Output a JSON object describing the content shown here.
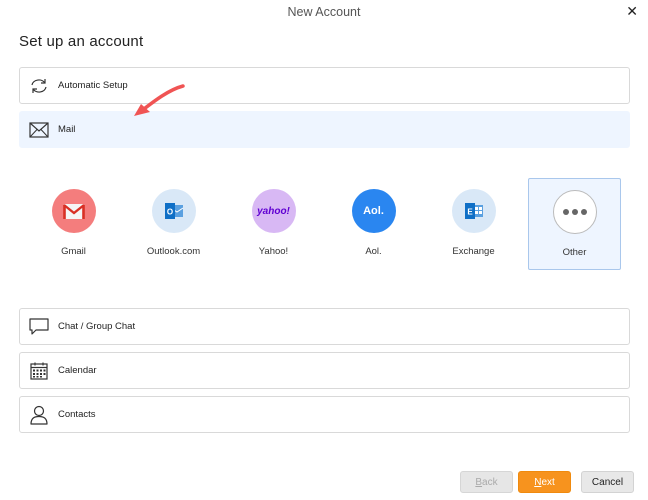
{
  "window": {
    "title": "New Account"
  },
  "heading": "Set up an account",
  "rows": [
    {
      "label": "Automatic Setup",
      "icon": "refresh-icon"
    },
    {
      "label": "Mail",
      "icon": "envelope-icon"
    },
    {
      "label": "Chat / Group Chat",
      "icon": "chat-bubble-icon"
    },
    {
      "label": "Calendar",
      "icon": "calendar-icon"
    },
    {
      "label": "Contacts",
      "icon": "person-icon"
    }
  ],
  "providers": [
    {
      "label": "Gmail",
      "color": "#f47d7d"
    },
    {
      "label": "Outlook.com",
      "color": "#d9e8f7"
    },
    {
      "label": "Yahoo!",
      "color": "#d8b8f4"
    },
    {
      "label": "Aol.",
      "logo_text": "Aol.",
      "color": "#2a86f0"
    },
    {
      "label": "Exchange",
      "color": "#d9e8f7"
    },
    {
      "label": "Other",
      "color": "#ffffff"
    }
  ],
  "yahoo_logo_text": "yahoo!",
  "buttons": {
    "back_first": "B",
    "back_rest": "ack",
    "next_first": "N",
    "next_rest": "ext",
    "cancel": "Cancel"
  },
  "annotation_color": "#f05454"
}
